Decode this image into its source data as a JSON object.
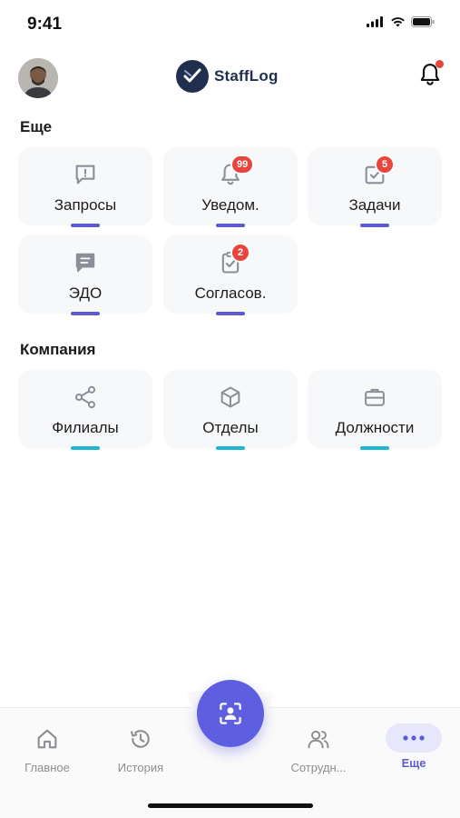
{
  "status": {
    "time": "9:41"
  },
  "brand": {
    "name": "StaffLog"
  },
  "sections": {
    "more": {
      "title": "Еще"
    },
    "company": {
      "title": "Компания"
    }
  },
  "tiles": {
    "requests": {
      "label": "Запросы"
    },
    "notifications": {
      "label": "Уведом.",
      "badge": "99"
    },
    "tasks": {
      "label": "Задачи",
      "badge": "5"
    },
    "edo": {
      "label": "ЭДО"
    },
    "approvals": {
      "label": "Согласов.",
      "badge": "2"
    },
    "branches": {
      "label": "Филиалы"
    },
    "departments": {
      "label": "Отделы"
    },
    "positions": {
      "label": "Должности"
    }
  },
  "nav": {
    "home": "Главное",
    "history": "История",
    "employees": "Сотрудн...",
    "more": "Еще"
  },
  "colors": {
    "accent": "#5e5fe0",
    "indigo_bar": "#5b5bd6",
    "cyan_bar": "#1fb6d3",
    "badge": "#e8453c",
    "brand": "#1f2f4d"
  }
}
